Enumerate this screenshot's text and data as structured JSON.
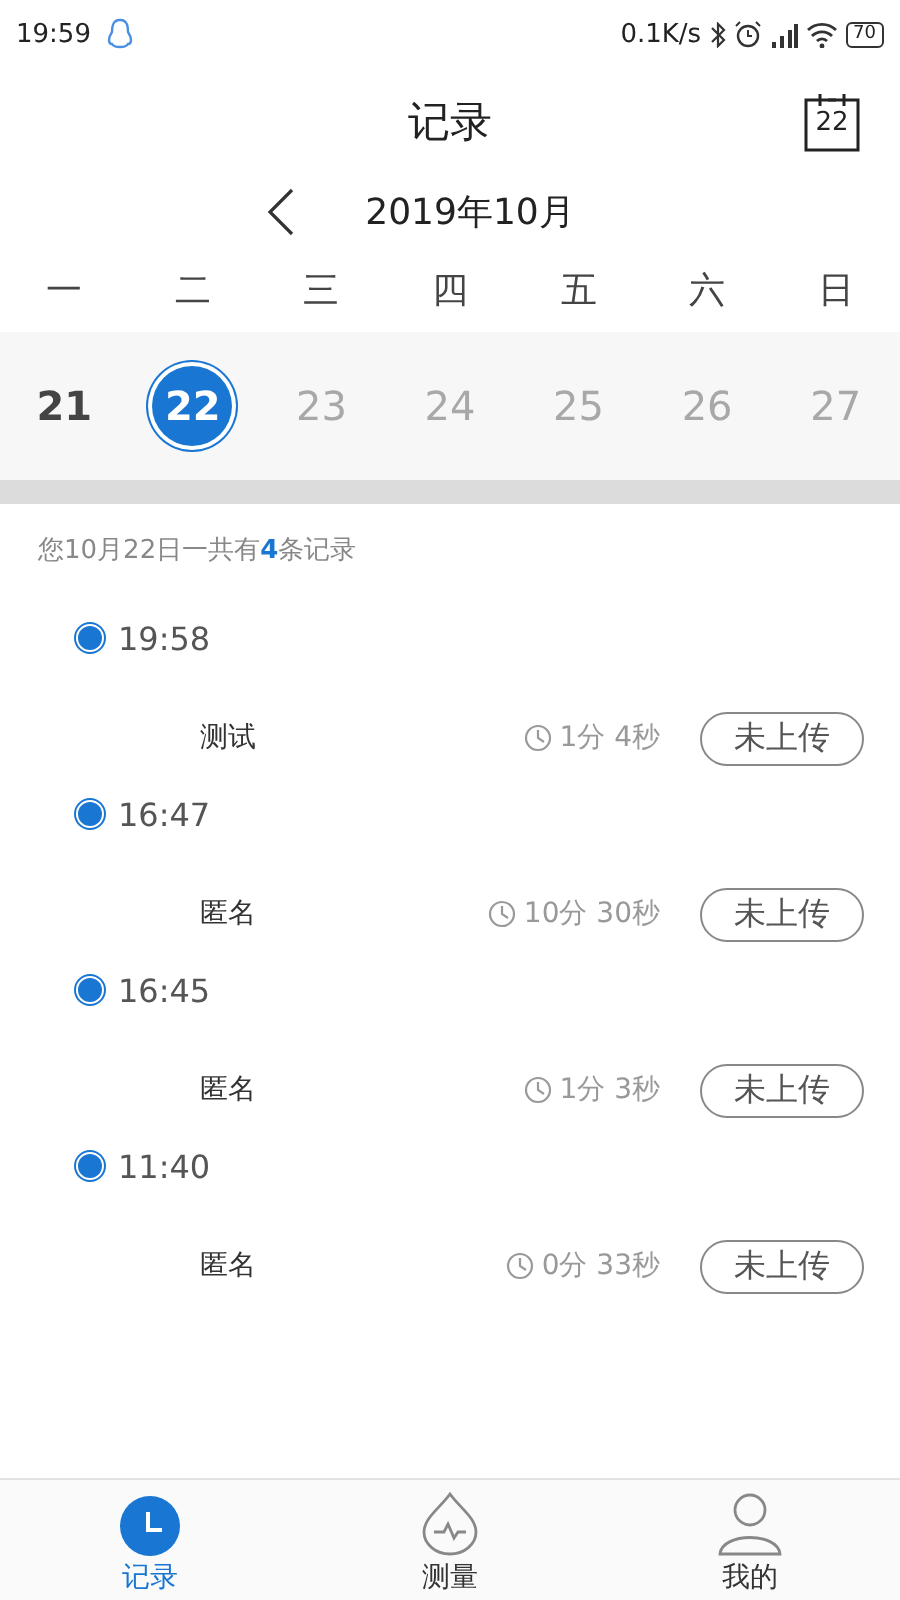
{
  "status_bar": {
    "time": "19:59",
    "speed": "0.1K/s",
    "battery": "70"
  },
  "header": {
    "title": "记录",
    "calendar_day": "22"
  },
  "month": {
    "label": "2019年10月"
  },
  "weekdays": [
    "一",
    "二",
    "三",
    "四",
    "五",
    "六",
    "日"
  ],
  "days": [
    {
      "label": "21",
      "selected": false,
      "muted": false
    },
    {
      "label": "22",
      "selected": true,
      "muted": false
    },
    {
      "label": "23",
      "selected": false,
      "muted": true
    },
    {
      "label": "24",
      "selected": false,
      "muted": true
    },
    {
      "label": "25",
      "selected": false,
      "muted": true
    },
    {
      "label": "26",
      "selected": false,
      "muted": true
    },
    {
      "label": "27",
      "selected": false,
      "muted": true
    }
  ],
  "summary": {
    "before": "您10月22日一共有",
    "count": "4",
    "after": "条记录"
  },
  "records": [
    {
      "time": "19:58",
      "name": "测试",
      "duration": "1分 4秒",
      "status": "未上传"
    },
    {
      "time": "16:47",
      "name": "匿名",
      "duration": "10分 30秒",
      "status": "未上传"
    },
    {
      "time": "16:45",
      "name": "匿名",
      "duration": "1分 3秒",
      "status": "未上传"
    },
    {
      "time": "11:40",
      "name": "匿名",
      "duration": "0分 33秒",
      "status": "未上传"
    }
  ],
  "nav": [
    {
      "label": "记录",
      "kind": "clock",
      "selected": true
    },
    {
      "label": "测量",
      "kind": "drop",
      "selected": false
    },
    {
      "label": "我的",
      "kind": "person",
      "selected": false
    }
  ]
}
